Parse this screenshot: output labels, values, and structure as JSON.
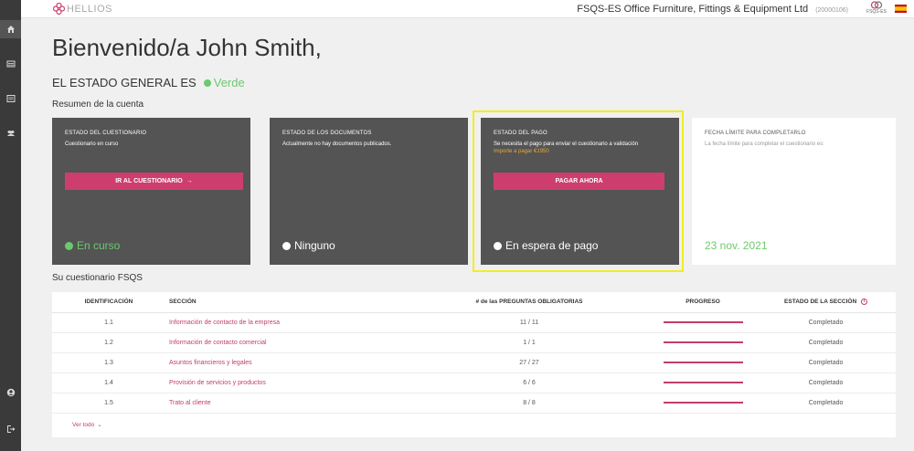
{
  "header": {
    "logo_text": "HELLIOS",
    "company_name": "FSQS-ES Office Furniture, Fittings & Equipment Ltd",
    "company_id": "(20000106)",
    "badge_label": "FSQS-ES",
    "flag": "spain-flag"
  },
  "sidebar": {
    "icons": [
      "home-icon",
      "list-icon",
      "document-icon",
      "users-icon",
      "user-icon",
      "logout-icon"
    ]
  },
  "welcome": "Bienvenido/a John Smith,",
  "status": {
    "label": "EL ESTADO GENERAL ES",
    "value": "Verde",
    "color": "#6dc96d"
  },
  "account_summary_title": "Resumen de la cuenta",
  "cards": {
    "questionnaire": {
      "title": "ESTADO DEL CUESTIONARIO",
      "desc": "Cuestionario en curso",
      "button": "IR AL CUESTIONARIO",
      "state": "En curso"
    },
    "documents": {
      "title": "ESTADO DE LOS DOCUMENTOS",
      "desc": "Actualmente no hay documentos publicados.",
      "state": "Ninguno"
    },
    "payment": {
      "title": "ESTADO DEL PAGO",
      "desc": "Se necesita el pago para enviar el cuestionario a validación",
      "amount": "Importe a pagar €1950",
      "button": "PAGAR AHORA",
      "state": "En espera de pago"
    },
    "deadline": {
      "title": "FECHA LÍMITE PARA COMPLETARLO",
      "desc": "La fecha límite para completar el cuestionario es:",
      "date": "23 nov. 2021"
    }
  },
  "questionnaire_title": "Su cuestionario FSQS",
  "table": {
    "headers": [
      "IDENTIFICACIÓN",
      "SECCIÓN",
      "# de las PREGUNTAS OBLIGATORIAS",
      "PROGRESO",
      "ESTADO DE LA SECCIÓN"
    ],
    "rows": [
      {
        "id": "1.1",
        "section": "Información de contacto de la empresa",
        "questions": "11 / 11",
        "progress": 1.0,
        "status": "Completado"
      },
      {
        "id": "1.2",
        "section": "Información de contacto comercial",
        "questions": "1 / 1",
        "progress": 1.0,
        "status": "Completado"
      },
      {
        "id": "1.3",
        "section": "Asuntos financieros y legales",
        "questions": "27 / 27",
        "progress": 1.0,
        "status": "Completado"
      },
      {
        "id": "1.4",
        "section": "Provisión de servicios y productos",
        "questions": "6 / 6",
        "progress": 1.0,
        "status": "Completado"
      },
      {
        "id": "1.5",
        "section": "Trato al cliente",
        "questions": "8 / 8",
        "progress": 1.0,
        "status": "Completado"
      }
    ],
    "view_all": "Ver todo"
  },
  "colors": {
    "accent": "#cd3e6e",
    "green": "#6dc96d",
    "card_dark": "#545454",
    "amount": "#e8a93a",
    "highlight": "#f0ed22"
  }
}
